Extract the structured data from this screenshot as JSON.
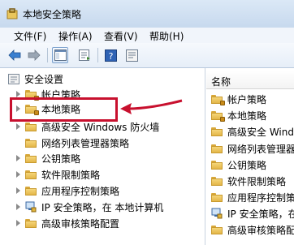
{
  "window": {
    "title": "本地安全策略"
  },
  "menu": [
    "文件(F)",
    "操作(A)",
    "查看(V)",
    "帮助(H)"
  ],
  "toolbar": {
    "buttons": [
      "back-icon",
      "forward-icon",
      "show-hide-tree-icon",
      "export-list-icon",
      "help-icon",
      "properties-icon"
    ]
  },
  "tree": {
    "root": "安全设置",
    "items": [
      {
        "label": "帐户策略",
        "expandable": true,
        "locked": true
      },
      {
        "label": "本地策略",
        "expandable": true,
        "locked": true,
        "highlighted": true
      },
      {
        "label": "高级安全 Windows 防火墙",
        "expandable": true,
        "locked": false
      },
      {
        "label": "网络列表管理器策略",
        "expandable": false,
        "locked": false
      },
      {
        "label": "公钥策略",
        "expandable": true,
        "locked": false
      },
      {
        "label": "软件限制策略",
        "expandable": true,
        "locked": false
      },
      {
        "label": "应用程序控制策略",
        "expandable": true,
        "locked": false
      },
      {
        "label": "IP 安全策略，在 本地计算机",
        "expandable": true,
        "locked": false,
        "icon": "ip-security-icon"
      },
      {
        "label": "高级审核策略配置",
        "expandable": true,
        "locked": false
      }
    ]
  },
  "list": {
    "header": "名称",
    "items": [
      {
        "label": "帐户策略",
        "locked": true
      },
      {
        "label": "本地策略",
        "locked": true
      },
      {
        "label": "高级安全 Wind",
        "locked": false
      },
      {
        "label": "网络列表管理器",
        "locked": false
      },
      {
        "label": "公钥策略",
        "locked": false
      },
      {
        "label": "软件限制策略",
        "locked": false
      },
      {
        "label": "应用程序控制策",
        "locked": false
      },
      {
        "label": "IP 安全策略，在",
        "locked": false,
        "icon": "ip-security-icon"
      },
      {
        "label": "高级审核策略配",
        "locked": false
      }
    ]
  },
  "colors": {
    "highlight": "#c8102e"
  }
}
